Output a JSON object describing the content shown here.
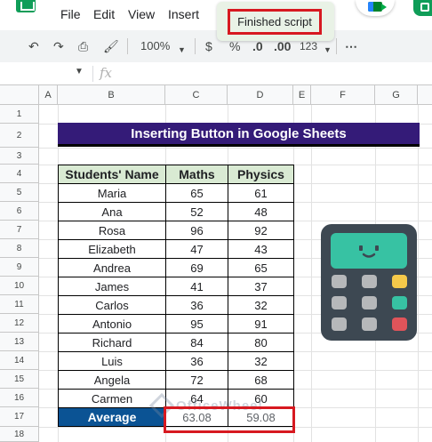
{
  "menu": {
    "items": [
      "File",
      "Edit",
      "View",
      "Insert"
    ]
  },
  "toast": {
    "text": "Finished script"
  },
  "toolbar": {
    "zoom": "100%",
    "currency": "$",
    "percent": "%",
    "decrease_decimal": ".0",
    "increase_decimal": ".00",
    "number_format": "123"
  },
  "formula_bar": {
    "fx": "fx"
  },
  "columns": [
    "A",
    "B",
    "C",
    "D",
    "E",
    "F",
    "G"
  ],
  "rows": [
    "1",
    "2",
    "3",
    "4",
    "5",
    "6",
    "7",
    "8",
    "9",
    "10",
    "11",
    "12",
    "13",
    "14",
    "15",
    "16",
    "17",
    "18"
  ],
  "sheet": {
    "title": "Inserting Button in Google Sheets",
    "headers": [
      "Students' Name",
      "Maths",
      "Physics"
    ],
    "students": [
      {
        "name": "Maria",
        "maths": "65",
        "physics": "61"
      },
      {
        "name": "Ana",
        "maths": "52",
        "physics": "48"
      },
      {
        "name": "Rosa",
        "maths": "96",
        "physics": "92"
      },
      {
        "name": "Elizabeth",
        "maths": "47",
        "physics": "43"
      },
      {
        "name": "Andrea",
        "maths": "69",
        "physics": "65"
      },
      {
        "name": "James",
        "maths": "41",
        "physics": "37"
      },
      {
        "name": "Carlos",
        "maths": "36",
        "physics": "32"
      },
      {
        "name": "Antonio",
        "maths": "95",
        "physics": "91"
      },
      {
        "name": "Richard",
        "maths": "84",
        "physics": "80"
      },
      {
        "name": "Luis",
        "maths": "36",
        "physics": "32"
      },
      {
        "name": "Angela",
        "maths": "72",
        "physics": "68"
      },
      {
        "name": "Carmen",
        "maths": "64",
        "physics": "60"
      }
    ],
    "average": {
      "label": "Average",
      "maths": "63.08",
      "physics": "59.08"
    }
  },
  "watermark": {
    "text": "OfficeWheel"
  },
  "colors": {
    "title_bg": "#341b78",
    "header_bg": "#d9ead3",
    "average_bg": "#0b5394",
    "highlight": "#d71920",
    "calculator_body": "#3d4852",
    "calculator_screen": "#37c2a3"
  }
}
